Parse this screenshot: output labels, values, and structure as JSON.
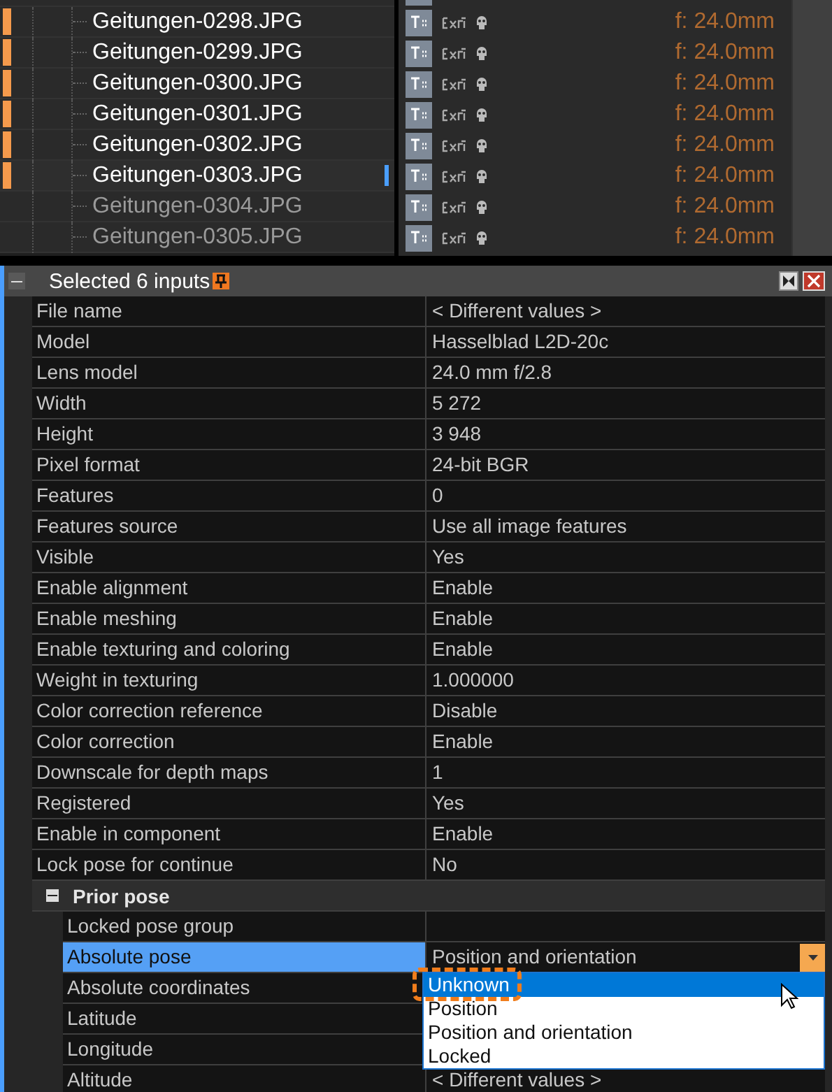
{
  "files": [
    {
      "name": "Geitungen-0298.JPG",
      "marked": true,
      "selected": false,
      "dimmed": false,
      "focal": "f: 24.0mm"
    },
    {
      "name": "Geitungen-0299.JPG",
      "marked": true,
      "selected": false,
      "dimmed": false,
      "focal": "f: 24.0mm"
    },
    {
      "name": "Geitungen-0300.JPG",
      "marked": true,
      "selected": false,
      "dimmed": false,
      "focal": "f: 24.0mm"
    },
    {
      "name": "Geitungen-0301.JPG",
      "marked": true,
      "selected": false,
      "dimmed": false,
      "focal": "f: 24.0mm"
    },
    {
      "name": "Geitungen-0302.JPG",
      "marked": true,
      "selected": false,
      "dimmed": false,
      "focal": "f: 24.0mm"
    },
    {
      "name": "Geitungen-0303.JPG",
      "marked": true,
      "selected": true,
      "dimmed": false,
      "focal": "f: 24.0mm"
    },
    {
      "name": "Geitungen-0304.JPG",
      "marked": false,
      "selected": false,
      "dimmed": true,
      "focal": "f: 24.0mm"
    },
    {
      "name": "Geitungen-0305.JPG",
      "marked": false,
      "selected": false,
      "dimmed": true,
      "focal": "f: 24.0mm"
    }
  ],
  "panel": {
    "title": "Selected 6 inputs",
    "expanded": true,
    "properties": [
      {
        "label": "File name",
        "value": "< Different values >"
      },
      {
        "label": "Model",
        "value": "Hasselblad L2D-20c"
      },
      {
        "label": "Lens model",
        "value": "24.0 mm f/2.8"
      },
      {
        "label": "Width",
        "value": "5 272"
      },
      {
        "label": "Height",
        "value": "3 948"
      },
      {
        "label": "Pixel format",
        "value": "24-bit BGR"
      },
      {
        "label": "Features",
        "value": "0"
      },
      {
        "label": "Features source",
        "value": "Use all image features"
      },
      {
        "label": "Visible",
        "value": "Yes"
      },
      {
        "label": "Enable alignment",
        "value": "Enable"
      },
      {
        "label": "Enable meshing",
        "value": "Enable"
      },
      {
        "label": "Enable texturing and coloring",
        "value": "Enable"
      },
      {
        "label": "Weight in texturing",
        "value": "1.000000"
      },
      {
        "label": "Color correction reference",
        "value": "Disable"
      },
      {
        "label": "Color correction",
        "value": "Enable"
      },
      {
        "label": "Downscale for depth maps",
        "value": "1"
      },
      {
        "label": "Registered",
        "value": "Yes"
      },
      {
        "label": "Enable in component",
        "value": "Enable"
      },
      {
        "label": "Lock pose for continue",
        "value": "No"
      }
    ],
    "group": {
      "title": "Prior pose",
      "expanded": true,
      "properties": [
        {
          "label": "Locked pose group",
          "selected": false
        },
        {
          "label": "Absolute pose",
          "value": "Position and orientation",
          "selected": true,
          "kind": "dropdown"
        },
        {
          "label": "Absolute coordinates",
          "selected": false
        },
        {
          "label": "Latitude",
          "selected": false
        },
        {
          "label": "Longitude",
          "selected": false
        },
        {
          "label": "Altitude",
          "value": "< Different values >",
          "selected": false
        }
      ]
    },
    "dropdown": {
      "options": [
        {
          "label": "Unknown",
          "selected": true
        },
        {
          "label": "Position",
          "selected": false
        },
        {
          "label": "Position and orientation",
          "selected": false
        },
        {
          "label": "Locked",
          "selected": false
        }
      ]
    }
  }
}
